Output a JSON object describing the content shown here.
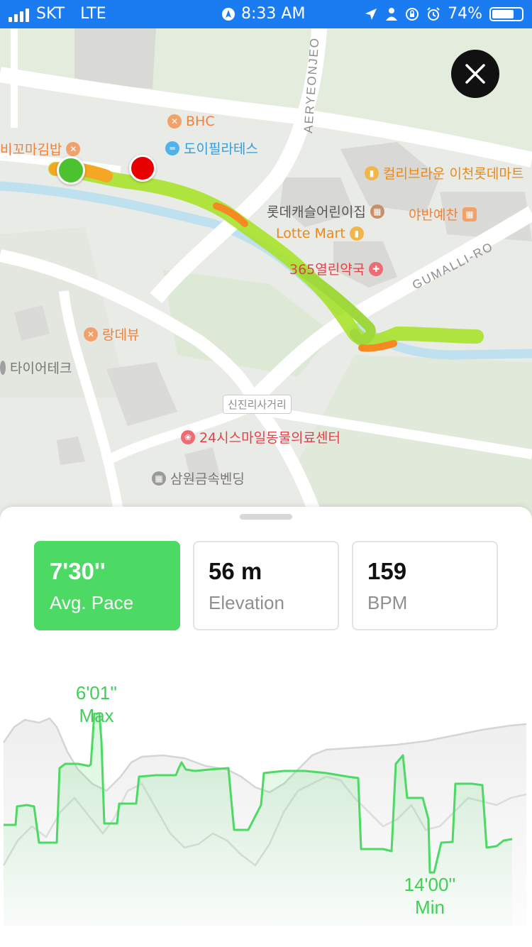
{
  "status": {
    "carrier": "SKT",
    "network": "LTE",
    "time": "8:33 AM",
    "battery": "74%",
    "battery_level": 0.74
  },
  "map": {
    "road_labels": [
      "AERYEONJEO",
      "GUMALLI-RO",
      "신진리사거리"
    ],
    "pois": [
      {
        "label": "BHC",
        "icon": "restaurant-icon"
      },
      {
        "label": "도이필라테스",
        "icon": "fitness-icon"
      },
      {
        "label": "비꼬마김밥",
        "icon": "restaurant-icon"
      },
      {
        "label": "컬리브라운 이천롯데마트",
        "icon": "shopping-icon"
      },
      {
        "label": "롯데캐슬어린이집",
        "icon": "building-icon"
      },
      {
        "label": "야반예찬",
        "icon": "restaurant-icon"
      },
      {
        "label": "Lotte Mart",
        "icon": "shopping-icon"
      },
      {
        "label": "365열린약국",
        "icon": "pharmacy-icon"
      },
      {
        "label": "랑데뷰",
        "icon": "restaurant-icon"
      },
      {
        "label": "타이어테크",
        "icon": "service-icon"
      },
      {
        "label": "24시스마일동물의료센터",
        "icon": "pet-icon"
      },
      {
        "label": "삼원금속벤딩",
        "icon": "building-icon"
      }
    ]
  },
  "stats": [
    {
      "value": "7'30''",
      "label": "Avg. Pace",
      "active": true
    },
    {
      "value": "56 m",
      "label": "Elevation",
      "active": false
    },
    {
      "value": "159",
      "label": "BPM",
      "active": false
    }
  ],
  "chart": {
    "max_value": "6'01''",
    "max_label": "Max",
    "min_value": "14'00''",
    "min_label": "Min"
  },
  "colors": {
    "accent": "#4cd964",
    "statusbar": "#1a7cf0",
    "route": "#a8e22b",
    "start_marker": "#4cc22e",
    "end_marker": "#e80000"
  }
}
